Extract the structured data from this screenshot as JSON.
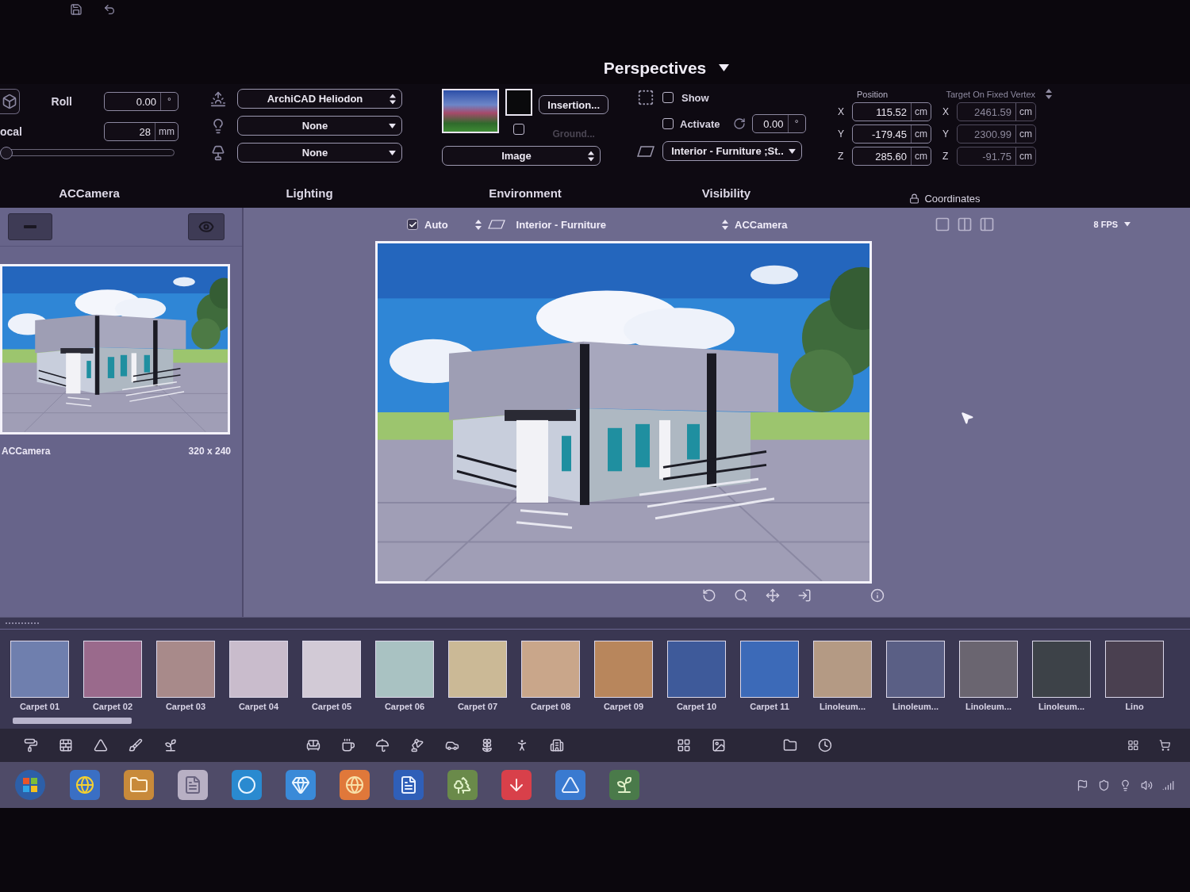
{
  "title": "Perspectives",
  "camera": {
    "roll_label": "Roll",
    "roll": {
      "value": "0.00",
      "unit": "°"
    },
    "focal_label": "ocal",
    "focal": {
      "value": "28",
      "unit": "mm"
    },
    "focal_slider": {
      "level": 0.03
    },
    "title": "ACCamera"
  },
  "lighting": {
    "selectors": [
      {
        "kind": "stepper",
        "value": "ArchiCAD Heliodon"
      },
      {
        "kind": "dropdown",
        "value": "None"
      },
      {
        "kind": "dropdown",
        "value": "None"
      }
    ],
    "title": "Lighting"
  },
  "environment": {
    "insertion_button": "Insertion...",
    "ground": {
      "label": "Ground...",
      "checked": false,
      "disabled": true
    },
    "mode": {
      "kind": "stepper",
      "value": "Image"
    },
    "title": "Environment"
  },
  "visibility": {
    "show": {
      "label": "Show",
      "checked": false
    },
    "activate": {
      "label": "Activate",
      "checked": false
    },
    "angle": {
      "value": "0.00",
      "unit": "°"
    },
    "layer": {
      "kind": "dropdown",
      "value": "Interior - Furniture ;St.."
    },
    "title": "Visibility"
  },
  "coordinates": {
    "position_label": "Position",
    "target_label": "Target On Fixed Vertex",
    "position": [
      {
        "axis": "X",
        "value": "115.52",
        "unit": "cm",
        "disabled": false
      },
      {
        "axis": "Y",
        "value": "-179.45",
        "unit": "cm",
        "disabled": false
      },
      {
        "axis": "Z",
        "value": "285.60",
        "unit": "cm",
        "disabled": false
      }
    ],
    "target": [
      {
        "axis": "X",
        "value": "2461.59",
        "unit": "cm",
        "disabled": true
      },
      {
        "axis": "Y",
        "value": "2300.99",
        "unit": "cm",
        "disabled": true
      },
      {
        "axis": "Z",
        "value": "-91.75",
        "unit": "cm",
        "disabled": true
      }
    ],
    "title": "Coordinates"
  },
  "preview": {
    "name": "ACCamera",
    "size": "320 x 240"
  },
  "viewer": {
    "auto": {
      "label": "Auto",
      "checked": true
    },
    "layer": "Interior - Furniture",
    "camera": "ACCamera",
    "fps": "8 FPS"
  },
  "materials": [
    {
      "name": "Carpet 01",
      "color": "#6f7fae"
    },
    {
      "name": "Carpet 02",
      "color": "#9a6a8c"
    },
    {
      "name": "Carpet 03",
      "color": "#a88a8a"
    },
    {
      "name": "Carpet 04",
      "color": "#c9bccc"
    },
    {
      "name": "Carpet 05",
      "color": "#d2cad6"
    },
    {
      "name": "Carpet 06",
      "color": "#a9c2c2"
    },
    {
      "name": "Carpet 07",
      "color": "#cbb996"
    },
    {
      "name": "Carpet 08",
      "color": "#c9a68a"
    },
    {
      "name": "Carpet 09",
      "color": "#b8865c"
    },
    {
      "name": "Carpet 10",
      "color": "#3e5a9a"
    },
    {
      "name": "Carpet 11",
      "color": "#3c6ab8"
    },
    {
      "name": "Linoleum...",
      "color": "#b49a84"
    },
    {
      "name": "Linoleum...",
      "color": "#5a5f85"
    },
    {
      "name": "Linoleum...",
      "color": "#6a6570"
    },
    {
      "name": "Linoleum...",
      "color": "#3d4248"
    },
    {
      "name": "Lino",
      "color": "#4a4050"
    }
  ]
}
